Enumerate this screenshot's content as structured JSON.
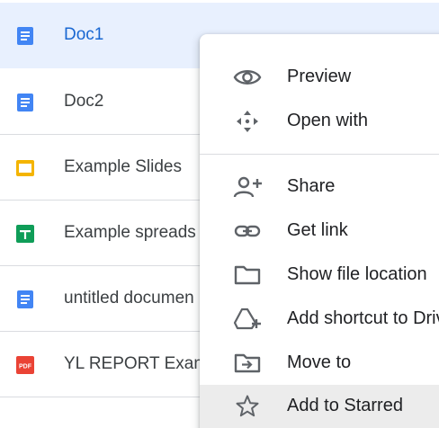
{
  "files": [
    {
      "name": "Doc1",
      "type": "doc-icon"
    },
    {
      "name": "Doc2",
      "type": "doc-icon"
    },
    {
      "name": "Example Slides",
      "type": "slides-icon"
    },
    {
      "name": "Example spreads",
      "type": "sheets-icon"
    },
    {
      "name": "untitled documen",
      "type": "doc-icon"
    },
    {
      "name": "YL REPORT Exam",
      "type": "pdf-icon",
      "badge": "PDF"
    }
  ],
  "selected_file": "Doc1",
  "menu": {
    "items": [
      {
        "label": "Preview",
        "icon": "eye-icon"
      },
      {
        "label": "Open with",
        "icon": "move-arrows-icon"
      },
      {
        "label": "Share",
        "icon": "person-add-icon"
      },
      {
        "label": "Get link",
        "icon": "link-icon"
      },
      {
        "label": "Show file location",
        "icon": "folder-icon"
      },
      {
        "label": "Add shortcut to Drive",
        "icon": "add-shortcut-icon"
      },
      {
        "label": "Move to",
        "icon": "move-to-folder-icon"
      },
      {
        "label": "Add to Starred",
        "icon": "star-icon"
      }
    ],
    "hovered_item": "Add to Starred"
  },
  "colors": {
    "selected_row_bg": "#e8f0fe",
    "selected_text": "#1967d2",
    "docs_blue": "#4285f4",
    "slides_yellow": "#f4b400",
    "sheets_green": "#0f9d58",
    "pdf_red": "#ea4335",
    "hover_bg": "#ececec"
  }
}
